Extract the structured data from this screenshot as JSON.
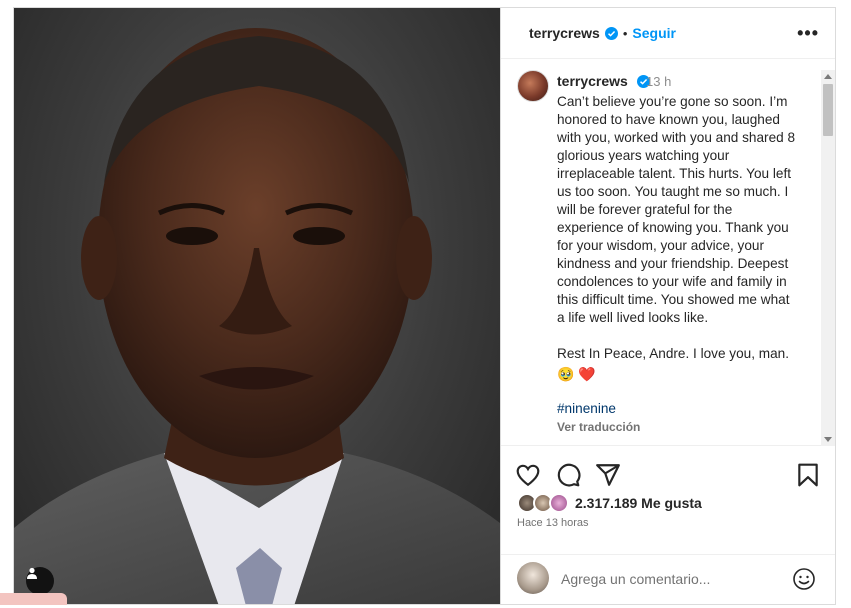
{
  "post": {
    "username": "terrycrews",
    "follow_label": "Seguir",
    "dot": "•",
    "more_label": "•••",
    "caption_user": "terrycrews",
    "caption_time": "13 h",
    "caption": "Can’t believe you’re gone so soon. I’m\nhonored to have known you, laughed\nwith you, worked with you and shared 8\nglorious years watching your\nirreplaceable talent. This hurts. You left\nus too soon. You taught me so much. I\nwill be forever grateful for the\nexperience of knowing you. Thank you\nfor your wisdom, your advice, your\nkindness and your friendship. Deepest\ncondolences to your wife and family in\nthis difficult time. You showed me what\na life well lived looks like.\n\nRest In Peace, Andre. I love you, man.",
    "emojis": "🥹 ❤️",
    "hashtag": "#ninenine",
    "translate_label": "Ver traducción",
    "likes": "2.317.189 Me gusta",
    "time_ago": "Hace 13 horas",
    "comment_placeholder": "Agrega un comentario..."
  },
  "colors": {
    "accent": "#0095f6",
    "verified": "#0095f6",
    "heart": "#ed4956",
    "text": "#262626",
    "muted": "#737373"
  },
  "icons": {
    "like": "heart-outline-icon",
    "comment": "comment-bubble-icon",
    "share": "paper-plane-icon",
    "save": "bookmark-icon",
    "tag": "user-tag-icon",
    "emoji": "smiley-icon",
    "verified": "verified-badge-icon"
  }
}
